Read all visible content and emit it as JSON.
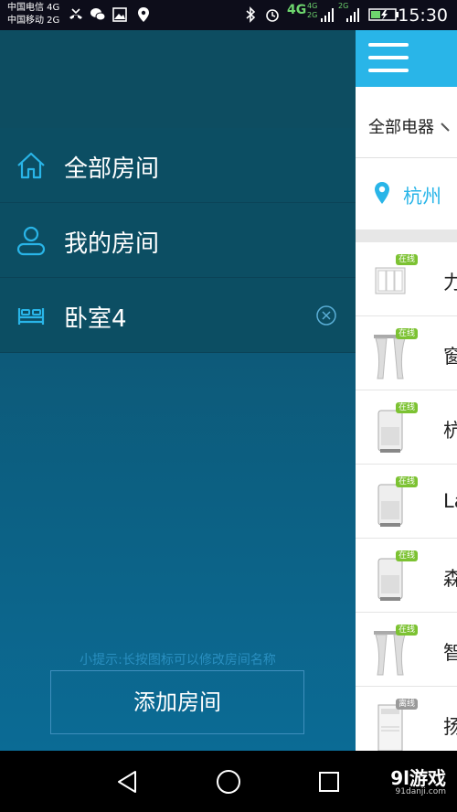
{
  "status_bar": {
    "carrier1": "中国电信 4G",
    "carrier2": "中国移动 2G",
    "net_4g": "4G",
    "net_4g_small": "4G",
    "net_2g_small_a": "2G",
    "net_2g_small_b": "2G",
    "time": "15:30"
  },
  "drawer": {
    "rooms": [
      {
        "label": "全部房间",
        "icon": "home-icon"
      },
      {
        "label": "我的房间",
        "icon": "person-icon"
      },
      {
        "label": "卧室4",
        "icon": "bed-icon"
      }
    ],
    "tip": "小提示:长按图标可以修改房间名称",
    "add_room": "添加房间"
  },
  "main": {
    "filter_label": "全部电器",
    "location": "杭州",
    "devices": [
      {
        "name": "力",
        "status": "在线",
        "icon": "switch-icon"
      },
      {
        "name": "窗",
        "status": "在线",
        "icon": "curtain-icon"
      },
      {
        "name": "杭",
        "status": "在线",
        "icon": "air-purifier-icon"
      },
      {
        "name": "La",
        "status": "在线",
        "icon": "air-purifier-icon"
      },
      {
        "name": "森",
        "status": "在线",
        "icon": "air-purifier-icon"
      },
      {
        "name": "智",
        "status": "在线",
        "icon": "curtain-icon"
      },
      {
        "name": "扬",
        "status": "离线",
        "icon": "air-conditioner-icon"
      }
    ]
  },
  "watermark": {
    "main": "9l游戏",
    "sub": "91danji.com"
  },
  "colors": {
    "accent": "#29b5e8",
    "drawer_top": "#0e4a5e",
    "drawer_bottom": "#0b6b95",
    "online_badge": "#7cc232",
    "offline_badge": "#9a9a9a"
  }
}
